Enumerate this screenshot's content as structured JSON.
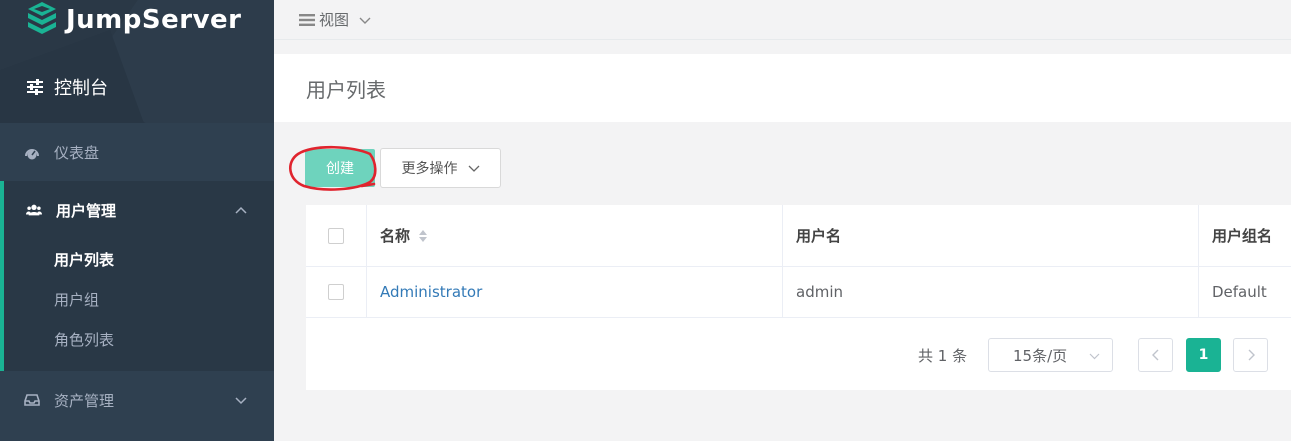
{
  "brand": {
    "name": "JumpServer",
    "accent": "#1ab394",
    "sidebar_bg": "#2f4050"
  },
  "sidebar": {
    "console_label": "控制台",
    "items": [
      {
        "label": "仪表盘",
        "icon": "dashboard-icon"
      },
      {
        "label": "用户管理",
        "icon": "users-icon",
        "expanded": true,
        "children": [
          {
            "label": "用户列表",
            "active": true
          },
          {
            "label": "用户组"
          },
          {
            "label": "角色列表"
          }
        ]
      },
      {
        "label": "资产管理",
        "icon": "inbox-icon",
        "expanded": false
      }
    ]
  },
  "topbar": {
    "view_label": "视图"
  },
  "page": {
    "title": "用户列表"
  },
  "toolbar": {
    "create_label": "创建",
    "more_label": "更多操作"
  },
  "table": {
    "columns": [
      "名称",
      "用户名",
      "用户组名"
    ],
    "rows": [
      {
        "name": "Administrator",
        "username": "admin",
        "group": "Default"
      }
    ]
  },
  "pagination": {
    "total_text": "共 1 条",
    "page_size": "15条/页",
    "current_page": "1"
  }
}
